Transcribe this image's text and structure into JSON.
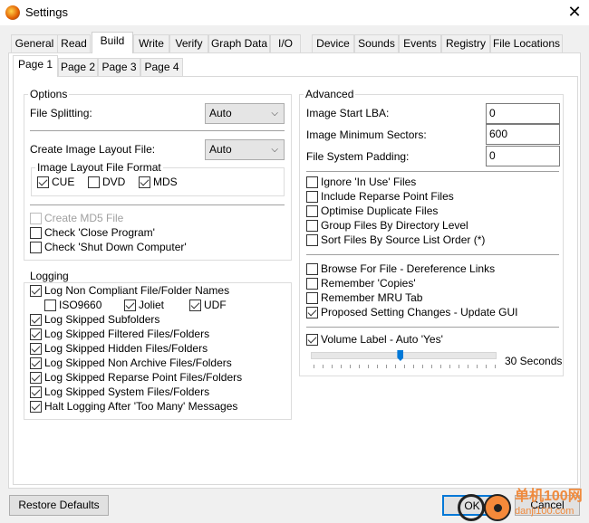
{
  "window": {
    "title": "Settings",
    "close_icon": "close-icon"
  },
  "tabs": [
    "General",
    "Read",
    "Build",
    "Write",
    "Verify",
    "Graph Data",
    "I/O",
    "Device",
    "Sounds",
    "Events",
    "Registry",
    "File Locations"
  ],
  "active_tab": "Build",
  "subtabs": [
    "Page 1",
    "Page 2",
    "Page 3",
    "Page 4"
  ],
  "active_subtab": "Page 1",
  "options": {
    "title": "Options",
    "file_splitting_label": "File Splitting:",
    "file_splitting_value": "Auto",
    "create_layout_label": "Create Image Layout File:",
    "create_layout_value": "Auto",
    "format_title": "Image Layout File Format",
    "formats": [
      {
        "label": "CUE",
        "checked": true
      },
      {
        "label": "DVD",
        "checked": false
      },
      {
        "label": "MDS",
        "checked": true
      }
    ],
    "checks": [
      {
        "label": "Create MD5 File",
        "checked": false,
        "disabled": true
      },
      {
        "label": "Check 'Close Program'",
        "checked": false
      },
      {
        "label": "Check 'Shut Down Computer'",
        "checked": false
      }
    ]
  },
  "logging": {
    "title": "Logging",
    "items": [
      {
        "label": "Log Non Compliant File/Folder Names",
        "checked": true
      },
      {
        "label": "ISO9660",
        "checked": false
      },
      {
        "label": "Joliet",
        "checked": true
      },
      {
        "label": "UDF",
        "checked": true
      },
      {
        "label": "Log Skipped Subfolders",
        "checked": true
      },
      {
        "label": "Log Skipped Filtered Files/Folders",
        "checked": true
      },
      {
        "label": "Log Skipped Hidden Files/Folders",
        "checked": true
      },
      {
        "label": "Log Skipped Non Archive Files/Folders",
        "checked": true
      },
      {
        "label": "Log Skipped Reparse Point Files/Folders",
        "checked": true
      },
      {
        "label": "Log Skipped System Files/Folders",
        "checked": true
      },
      {
        "label": "Halt Logging After 'Too Many' Messages",
        "checked": true
      }
    ]
  },
  "advanced": {
    "title": "Advanced",
    "fields": [
      {
        "label": "Image Start LBA:",
        "value": "0"
      },
      {
        "label": "Image Minimum Sectors:",
        "value": "600"
      },
      {
        "label": "File System Padding:",
        "value": "0"
      }
    ],
    "checks": [
      {
        "label": "Ignore 'In Use' Files",
        "checked": false
      },
      {
        "label": "Include Reparse Point Files",
        "checked": false
      },
      {
        "label": "Optimise Duplicate Files",
        "checked": false
      },
      {
        "label": "Group Files By Directory Level",
        "checked": false
      },
      {
        "label": "Sort Files By Source List Order (*)",
        "checked": false
      },
      {
        "label": "Browse For File - Dereference Links",
        "checked": false
      },
      {
        "label": "Remember 'Copies'",
        "checked": false
      },
      {
        "label": "Remember MRU Tab",
        "checked": false
      },
      {
        "label": "Proposed Setting Changes - Update GUI",
        "checked": true
      },
      {
        "label": "Volume Label - Auto 'Yes'",
        "checked": true
      }
    ],
    "slider": {
      "value_fraction": 0.48,
      "label": "30 Seconds"
    }
  },
  "buttons": {
    "restore": "Restore Defaults",
    "ok": "OK",
    "cancel": "Cancel"
  },
  "watermark": {
    "line1": "单机100网",
    "line2": "danji100.com"
  },
  "colors": {
    "accent": "#0078d7",
    "watermark": "#f08a3c"
  }
}
